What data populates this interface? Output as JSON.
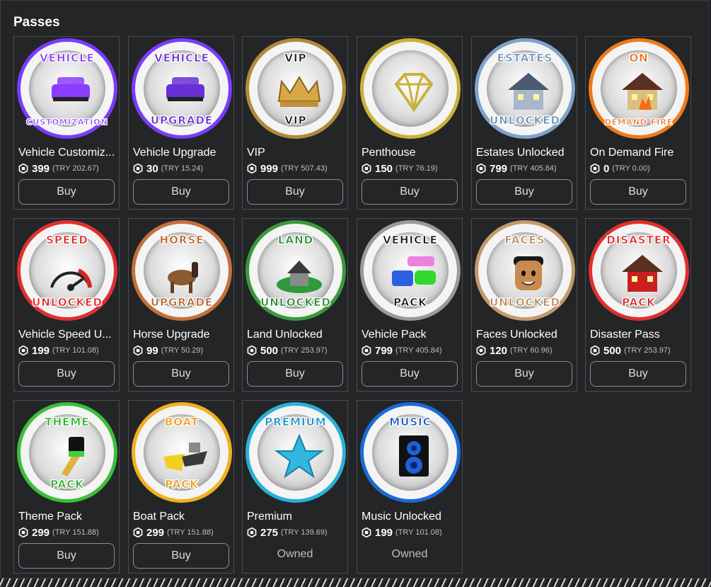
{
  "title": "Passes",
  "buy_label": "Buy",
  "owned_label": "Owned",
  "passes": [
    {
      "name": "Vehicle Customiz...",
      "price": "399",
      "try": "(TRY 202.67)",
      "badge_top": "VEHICLE",
      "badge_bottom": "CUSTOMIZATION",
      "ring": "#7a3cff",
      "color": "#8a3cff",
      "icon": "car-icon",
      "owned": false
    },
    {
      "name": "Vehicle Upgrade",
      "price": "30",
      "try": "(TRY 15.24)",
      "badge_top": "VEHICLE",
      "badge_bottom": "UPGRADE",
      "ring": "#7a3cff",
      "color": "#6a2ed6",
      "icon": "car-icon",
      "owned": false
    },
    {
      "name": "VIP",
      "price": "999",
      "try": "(TRY 507.43)",
      "badge_top": "VIP",
      "badge_bottom": "VIP",
      "ring": "#b08a3a",
      "color": "#1a1a1a",
      "icon": "crown-icon",
      "owned": false
    },
    {
      "name": "Penthouse",
      "price": "150",
      "try": "(TRY 76.19)",
      "badge_top": "",
      "badge_bottom": "",
      "ring": "#c9b23a",
      "color": "#c9b23a",
      "icon": "diamond-icon",
      "owned": false
    },
    {
      "name": "Estates Unlocked",
      "price": "799",
      "try": "(TRY 405.84)",
      "badge_top": "ESTATES",
      "badge_bottom": "UNLOCKED",
      "ring": "#7fa3c9",
      "color": "#6a8fb8",
      "icon": "house-icon",
      "owned": false
    },
    {
      "name": "On Demand Fire",
      "price": "0",
      "try": "(TRY 0.00)",
      "badge_top": "ON",
      "badge_bottom": "DEMAND FIRE",
      "ring": "#f07a1a",
      "color": "#ee6a12",
      "icon": "fire-house-icon",
      "owned": false
    },
    {
      "name": "Vehicle Speed U...",
      "price": "199",
      "try": "(TRY 101.08)",
      "badge_top": "SPEED",
      "badge_bottom": "UNLOCKED",
      "ring": "#e03030",
      "color": "#e02a2a",
      "icon": "speedometer-icon",
      "owned": false
    },
    {
      "name": "Horse Upgrade",
      "price": "99",
      "try": "(TRY 50.29)",
      "badge_top": "HORSE",
      "badge_bottom": "UPGRADE",
      "ring": "#c4703a",
      "color": "#b8622e",
      "icon": "horse-icon",
      "owned": false
    },
    {
      "name": "Land Unlocked",
      "price": "500",
      "try": "(TRY 253.97)",
      "badge_top": "LAND",
      "badge_bottom": "UNLOCKED",
      "ring": "#3a9a3a",
      "color": "#2e8a2e",
      "icon": "land-icon",
      "owned": false
    },
    {
      "name": "Vehicle Pack",
      "price": "799",
      "try": "(TRY 405.84)",
      "badge_top": "VEHICLE",
      "badge_bottom": "PACK",
      "ring": "#9a9a9a",
      "color": "#1a1a1a",
      "icon": "vehicles-icon",
      "owned": false
    },
    {
      "name": "Faces Unlocked",
      "price": "120",
      "try": "(TRY 60.96)",
      "badge_top": "FACES",
      "badge_bottom": "UNLOCKED",
      "ring": "#c49a6a",
      "color": "#b88a5a",
      "icon": "face-icon",
      "owned": false
    },
    {
      "name": "Disaster Pass",
      "price": "500",
      "try": "(TRY 253.97)",
      "badge_top": "DISASTER",
      "badge_bottom": "PACK",
      "ring": "#e03030",
      "color": "#d82a2a",
      "icon": "disaster-house-icon",
      "owned": false
    },
    {
      "name": "Theme Pack",
      "price": "299",
      "try": "(TRY 151.88)",
      "badge_top": "THEME",
      "badge_bottom": "PACK",
      "ring": "#3ac03a",
      "color": "#2eb02e",
      "icon": "paintbrush-icon",
      "owned": false
    },
    {
      "name": "Boat Pack",
      "price": "299",
      "try": "(TRY 151.88)",
      "badge_top": "BOAT",
      "badge_bottom": "PACK",
      "ring": "#f0b020",
      "color": "#ee9a12",
      "icon": "boat-icon",
      "owned": false
    },
    {
      "name": "Premium",
      "price": "275",
      "try": "(TRY 139.69)",
      "badge_top": "PREMIUM",
      "badge_bottom": "",
      "ring": "#2ab0d8",
      "color": "#1a90c8",
      "icon": "star-icon",
      "owned": true
    },
    {
      "name": "Music Unlocked",
      "price": "199",
      "try": "(TRY 101.08)",
      "badge_top": "MUSIC",
      "badge_bottom": "",
      "ring": "#1a6ad8",
      "color": "#1a5ac8",
      "icon": "speaker-icon",
      "owned": true
    }
  ]
}
